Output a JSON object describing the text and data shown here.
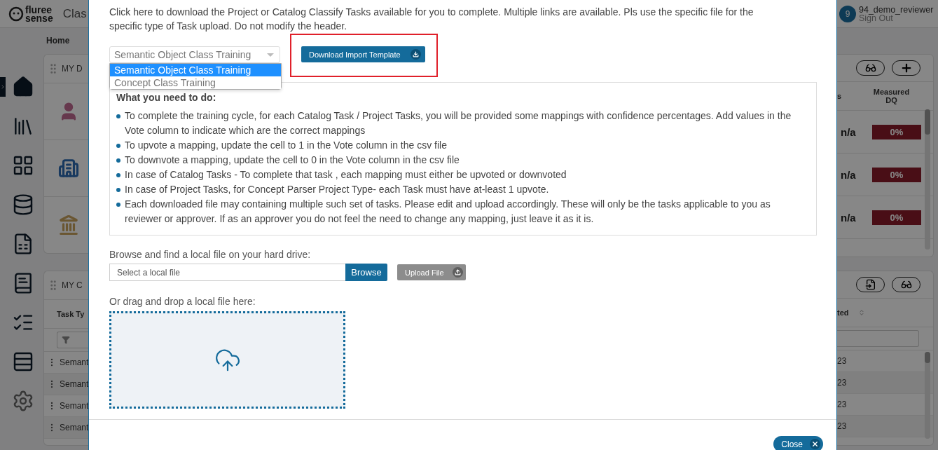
{
  "header": {
    "logo_top": "fluree",
    "logo_bottom": "sense",
    "title": "Clas",
    "avatar": "9",
    "user": "94_demo_reviewer",
    "sign_out": "Sign Out"
  },
  "breadcrumb": "Home",
  "dashboard_panel": {
    "title": "MY D",
    "columns": [
      "s",
      "Measured DQ"
    ],
    "rows": [
      {
        "value": "n/a",
        "dq": "0%"
      },
      {
        "value": "n/a",
        "dq": "0%"
      },
      {
        "value": "n/a",
        "dq": "0%"
      }
    ]
  },
  "tasks_panel": {
    "title": "MY C",
    "columns": [
      "Task Ty",
      "ted"
    ],
    "rows": [
      {
        "type": "Semant",
        "date": "23"
      },
      {
        "type": "Semant",
        "date": "23"
      },
      {
        "type": "Semant",
        "date": "23"
      },
      {
        "type": "Semant",
        "date": "23"
      }
    ]
  },
  "modal": {
    "intro": "Click here to download the Project or Catalog Classify Tasks available for you to complete. Multiple links are available. Pls use the specific file for the specific type of Task upload. Do not modify the header.",
    "select": {
      "value": "Semantic Object Class Training",
      "options": [
        {
          "label": "Semantic Object Class Training",
          "selected": true
        },
        {
          "label": "Concept Class Training",
          "selected": false
        }
      ]
    },
    "download_button": {
      "label": "Download Import Template",
      "highlighted": true
    },
    "instructions": {
      "title": "What you need to do:",
      "items": [
        "To complete the training cycle, for each Catalog Task / Project Tasks, you will be provided some mappings with confidence percentages. Add values in the Vote column to indicate which are the correct mappings",
        "To upvote a mapping, update the cell to 1 in the Vote column in the csv file",
        "To downvote a mapping, update the cell to 0 in the Vote column in the csv file",
        "In case of Catalog Tasks - To complete that task , each mapping must either be upvoted or downvoted",
        "In case of Project Tasks, for Concept Parser Project Type- each Task must have at-least 1 upvote.",
        "Each downloaded file may containing multiple such set of tasks. Please edit and upload accordingly. These will only be the tasks applicable to you as reviewer or approver. If as an approver you do not feel the need to change any mapping, just leave it as it is."
      ]
    },
    "file_label": "Browse and find a local file on your hard drive:",
    "file_field": {
      "placeholder": "Select a local file"
    },
    "browse_button": "Browse",
    "upload_button": {
      "label": "Upload File",
      "disabled": true
    },
    "drop_label": "Or drag and drop a local file here:",
    "close_button": "Close"
  }
}
